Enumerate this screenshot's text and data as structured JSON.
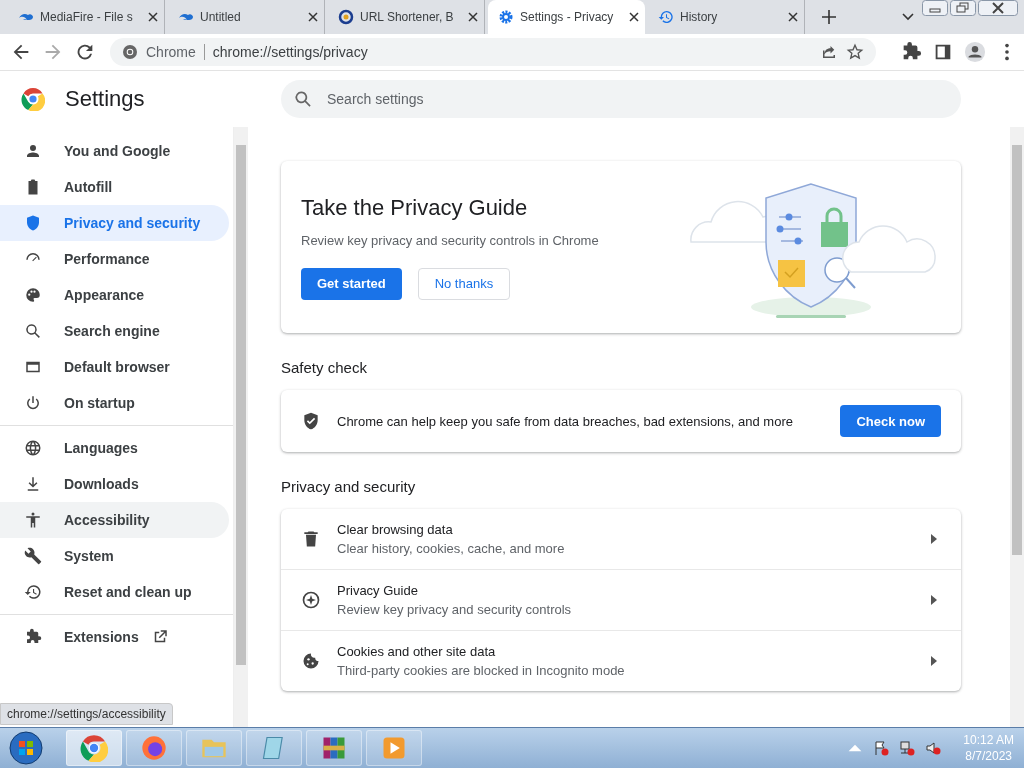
{
  "tabs": [
    {
      "title": "MediaFire - File s",
      "selected": false
    },
    {
      "title": "Untitled",
      "selected": false
    },
    {
      "title": "URL Shortener, B",
      "selected": false
    },
    {
      "title": "Settings - Privacy",
      "selected": true
    },
    {
      "title": "History",
      "selected": false
    }
  ],
  "address": {
    "site": "Chrome",
    "url": "chrome://settings/privacy"
  },
  "header": {
    "title": "Settings",
    "search_placeholder": "Search settings"
  },
  "sidebar": {
    "items": [
      {
        "label": "You and Google",
        "selected": false,
        "hovered": false
      },
      {
        "label": "Autofill",
        "selected": false,
        "hovered": false
      },
      {
        "label": "Privacy and security",
        "selected": true,
        "hovered": false
      },
      {
        "label": "Performance",
        "selected": false,
        "hovered": false
      },
      {
        "label": "Appearance",
        "selected": false,
        "hovered": false
      },
      {
        "label": "Search engine",
        "selected": false,
        "hovered": false
      },
      {
        "label": "Default browser",
        "selected": false,
        "hovered": false
      },
      {
        "label": "On startup",
        "selected": false,
        "hovered": false
      }
    ],
    "advanced": [
      {
        "label": "Languages",
        "selected": false,
        "hovered": false
      },
      {
        "label": "Downloads",
        "selected": false,
        "hovered": false
      },
      {
        "label": "Accessibility",
        "selected": false,
        "hovered": true
      },
      {
        "label": "System",
        "selected": false,
        "hovered": false
      },
      {
        "label": "Reset and clean up",
        "selected": false,
        "hovered": false
      }
    ],
    "extensions": "Extensions"
  },
  "privacy_guide": {
    "title": "Take the Privacy Guide",
    "text": "Review key privacy and security controls in Chrome",
    "primary": "Get started",
    "secondary": "No thanks"
  },
  "safety_check": {
    "heading": "Safety check",
    "text": "Chrome can help keep you safe from data breaches, bad extensions, and more",
    "button": "Check now"
  },
  "privacy_section": {
    "heading": "Privacy and security",
    "rows": [
      {
        "title": "Clear browsing data",
        "subtitle": "Clear history, cookies, cache, and more"
      },
      {
        "title": "Privacy Guide",
        "subtitle": "Review key privacy and security controls"
      },
      {
        "title": "Cookies and other site data",
        "subtitle": "Third-party cookies are blocked in Incognito mode"
      }
    ]
  },
  "status_bubble": "chrome://settings/accessibility",
  "taskbar": {
    "time": "10:12 AM",
    "date": "8/7/2023"
  }
}
